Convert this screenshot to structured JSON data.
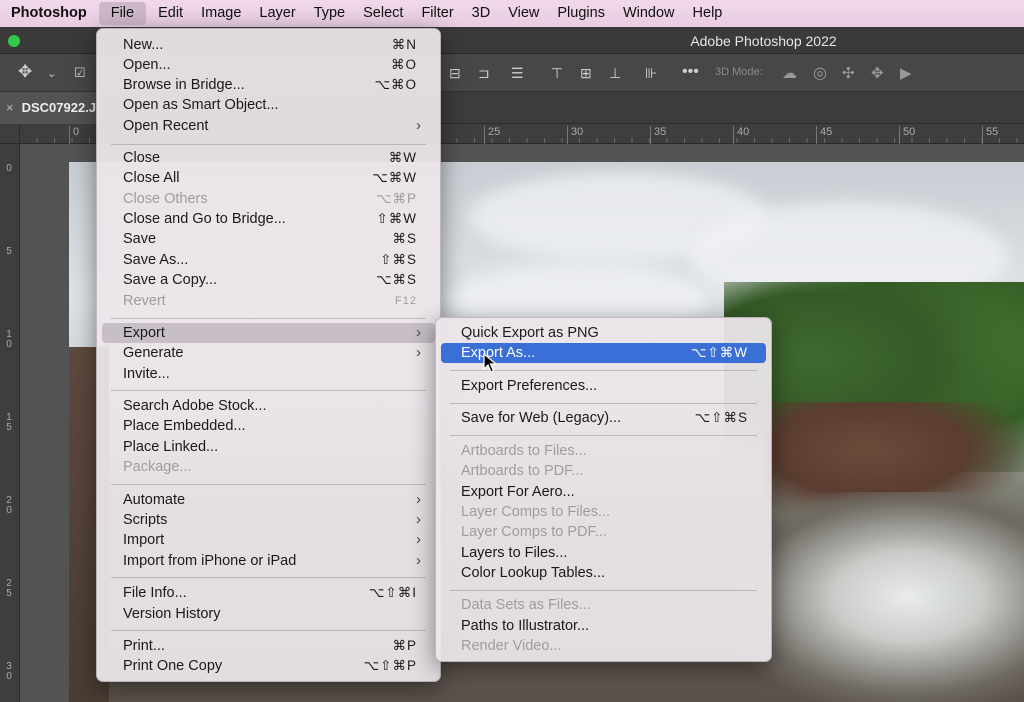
{
  "menubar": {
    "app": "Photoshop",
    "items": [
      "File",
      "Edit",
      "Image",
      "Layer",
      "Type",
      "Select",
      "Filter",
      "3D",
      "View",
      "Plugins",
      "Window",
      "Help"
    ]
  },
  "window": {
    "title": "Adobe Photoshop 2022"
  },
  "optionsbar": {
    "threed_label": "3D Mode:"
  },
  "document": {
    "tab_name": "DSC07922.J"
  },
  "ruler": {
    "top": [
      "0",
      "25",
      "30",
      "35",
      "40",
      "45",
      "50",
      "55"
    ],
    "left": [
      "0",
      "5",
      "10",
      "15",
      "20",
      "25",
      "30"
    ]
  },
  "file_menu": {
    "items": [
      {
        "label": "New...",
        "shortcut": "⌘N"
      },
      {
        "label": "Open...",
        "shortcut": "⌘O"
      },
      {
        "label": "Browse in Bridge...",
        "shortcut": "⌥⌘O"
      },
      {
        "label": "Open as Smart Object...",
        "shortcut": ""
      },
      {
        "label": "Open Recent",
        "shortcut": ""
      },
      {
        "label": "Close",
        "shortcut": "⌘W"
      },
      {
        "label": "Close All",
        "shortcut": "⌥⌘W"
      },
      {
        "label": "Close Others",
        "shortcut": "⌥⌘P"
      },
      {
        "label": "Close and Go to Bridge...",
        "shortcut": "⇧⌘W"
      },
      {
        "label": "Save",
        "shortcut": "⌘S"
      },
      {
        "label": "Save As...",
        "shortcut": "⇧⌘S"
      },
      {
        "label": "Save a Copy...",
        "shortcut": "⌥⌘S"
      },
      {
        "label": "Revert",
        "shortcut": "F12"
      },
      {
        "label": "Export",
        "shortcut": ""
      },
      {
        "label": "Generate",
        "shortcut": ""
      },
      {
        "label": "Invite...",
        "shortcut": ""
      },
      {
        "label": "Search Adobe Stock...",
        "shortcut": ""
      },
      {
        "label": "Place Embedded...",
        "shortcut": ""
      },
      {
        "label": "Place Linked...",
        "shortcut": ""
      },
      {
        "label": "Package...",
        "shortcut": ""
      },
      {
        "label": "Automate",
        "shortcut": ""
      },
      {
        "label": "Scripts",
        "shortcut": ""
      },
      {
        "label": "Import",
        "shortcut": ""
      },
      {
        "label": "Import from iPhone or iPad",
        "shortcut": ""
      },
      {
        "label": "File Info...",
        "shortcut": "⌥⇧⌘I"
      },
      {
        "label": "Version History",
        "shortcut": ""
      },
      {
        "label": "Print...",
        "shortcut": "⌘P"
      },
      {
        "label": "Print One Copy",
        "shortcut": "⌥⇧⌘P"
      }
    ]
  },
  "export_submenu": {
    "items": [
      {
        "label": "Quick Export as PNG",
        "shortcut": ""
      },
      {
        "label": "Export As...",
        "shortcut": "⌥⇧⌘W"
      },
      {
        "label": "Export Preferences...",
        "shortcut": ""
      },
      {
        "label": "Save for Web (Legacy)...",
        "shortcut": "⌥⇧⌘S"
      },
      {
        "label": "Artboards to Files...",
        "shortcut": ""
      },
      {
        "label": "Artboards to PDF...",
        "shortcut": ""
      },
      {
        "label": "Export For Aero...",
        "shortcut": ""
      },
      {
        "label": "Layer Comps to Files...",
        "shortcut": ""
      },
      {
        "label": "Layer Comps to PDF...",
        "shortcut": ""
      },
      {
        "label": "Layers to Files...",
        "shortcut": ""
      },
      {
        "label": "Color Lookup Tables...",
        "shortcut": ""
      },
      {
        "label": "Data Sets as Files...",
        "shortcut": ""
      },
      {
        "label": "Paths to Illustrator...",
        "shortcut": ""
      },
      {
        "label": "Render Video...",
        "shortcut": ""
      }
    ]
  },
  "colors": {
    "highlight": "#3b6fd8",
    "menubar": "#ecd3e6",
    "disabled": "#a19ba0"
  }
}
